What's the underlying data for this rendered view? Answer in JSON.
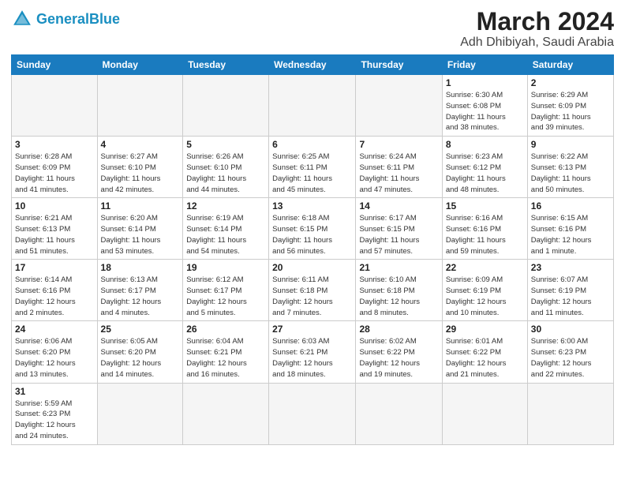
{
  "header": {
    "logo_general": "General",
    "logo_blue": "Blue",
    "title": "March 2024",
    "subtitle": "Adh Dhibiyah, Saudi Arabia"
  },
  "weekdays": [
    "Sunday",
    "Monday",
    "Tuesday",
    "Wednesday",
    "Thursday",
    "Friday",
    "Saturday"
  ],
  "weeks": [
    [
      {
        "day": "",
        "info": ""
      },
      {
        "day": "",
        "info": ""
      },
      {
        "day": "",
        "info": ""
      },
      {
        "day": "",
        "info": ""
      },
      {
        "day": "",
        "info": ""
      },
      {
        "day": "1",
        "info": "Sunrise: 6:30 AM\nSunset: 6:08 PM\nDaylight: 11 hours\nand 38 minutes."
      },
      {
        "day": "2",
        "info": "Sunrise: 6:29 AM\nSunset: 6:09 PM\nDaylight: 11 hours\nand 39 minutes."
      }
    ],
    [
      {
        "day": "3",
        "info": "Sunrise: 6:28 AM\nSunset: 6:09 PM\nDaylight: 11 hours\nand 41 minutes."
      },
      {
        "day": "4",
        "info": "Sunrise: 6:27 AM\nSunset: 6:10 PM\nDaylight: 11 hours\nand 42 minutes."
      },
      {
        "day": "5",
        "info": "Sunrise: 6:26 AM\nSunset: 6:10 PM\nDaylight: 11 hours\nand 44 minutes."
      },
      {
        "day": "6",
        "info": "Sunrise: 6:25 AM\nSunset: 6:11 PM\nDaylight: 11 hours\nand 45 minutes."
      },
      {
        "day": "7",
        "info": "Sunrise: 6:24 AM\nSunset: 6:11 PM\nDaylight: 11 hours\nand 47 minutes."
      },
      {
        "day": "8",
        "info": "Sunrise: 6:23 AM\nSunset: 6:12 PM\nDaylight: 11 hours\nand 48 minutes."
      },
      {
        "day": "9",
        "info": "Sunrise: 6:22 AM\nSunset: 6:13 PM\nDaylight: 11 hours\nand 50 minutes."
      }
    ],
    [
      {
        "day": "10",
        "info": "Sunrise: 6:21 AM\nSunset: 6:13 PM\nDaylight: 11 hours\nand 51 minutes."
      },
      {
        "day": "11",
        "info": "Sunrise: 6:20 AM\nSunset: 6:14 PM\nDaylight: 11 hours\nand 53 minutes."
      },
      {
        "day": "12",
        "info": "Sunrise: 6:19 AM\nSunset: 6:14 PM\nDaylight: 11 hours\nand 54 minutes."
      },
      {
        "day": "13",
        "info": "Sunrise: 6:18 AM\nSunset: 6:15 PM\nDaylight: 11 hours\nand 56 minutes."
      },
      {
        "day": "14",
        "info": "Sunrise: 6:17 AM\nSunset: 6:15 PM\nDaylight: 11 hours\nand 57 minutes."
      },
      {
        "day": "15",
        "info": "Sunrise: 6:16 AM\nSunset: 6:16 PM\nDaylight: 11 hours\nand 59 minutes."
      },
      {
        "day": "16",
        "info": "Sunrise: 6:15 AM\nSunset: 6:16 PM\nDaylight: 12 hours\nand 1 minute."
      }
    ],
    [
      {
        "day": "17",
        "info": "Sunrise: 6:14 AM\nSunset: 6:16 PM\nDaylight: 12 hours\nand 2 minutes."
      },
      {
        "day": "18",
        "info": "Sunrise: 6:13 AM\nSunset: 6:17 PM\nDaylight: 12 hours\nand 4 minutes."
      },
      {
        "day": "19",
        "info": "Sunrise: 6:12 AM\nSunset: 6:17 PM\nDaylight: 12 hours\nand 5 minutes."
      },
      {
        "day": "20",
        "info": "Sunrise: 6:11 AM\nSunset: 6:18 PM\nDaylight: 12 hours\nand 7 minutes."
      },
      {
        "day": "21",
        "info": "Sunrise: 6:10 AM\nSunset: 6:18 PM\nDaylight: 12 hours\nand 8 minutes."
      },
      {
        "day": "22",
        "info": "Sunrise: 6:09 AM\nSunset: 6:19 PM\nDaylight: 12 hours\nand 10 minutes."
      },
      {
        "day": "23",
        "info": "Sunrise: 6:07 AM\nSunset: 6:19 PM\nDaylight: 12 hours\nand 11 minutes."
      }
    ],
    [
      {
        "day": "24",
        "info": "Sunrise: 6:06 AM\nSunset: 6:20 PM\nDaylight: 12 hours\nand 13 minutes."
      },
      {
        "day": "25",
        "info": "Sunrise: 6:05 AM\nSunset: 6:20 PM\nDaylight: 12 hours\nand 14 minutes."
      },
      {
        "day": "26",
        "info": "Sunrise: 6:04 AM\nSunset: 6:21 PM\nDaylight: 12 hours\nand 16 minutes."
      },
      {
        "day": "27",
        "info": "Sunrise: 6:03 AM\nSunset: 6:21 PM\nDaylight: 12 hours\nand 18 minutes."
      },
      {
        "day": "28",
        "info": "Sunrise: 6:02 AM\nSunset: 6:22 PM\nDaylight: 12 hours\nand 19 minutes."
      },
      {
        "day": "29",
        "info": "Sunrise: 6:01 AM\nSunset: 6:22 PM\nDaylight: 12 hours\nand 21 minutes."
      },
      {
        "day": "30",
        "info": "Sunrise: 6:00 AM\nSunset: 6:23 PM\nDaylight: 12 hours\nand 22 minutes."
      }
    ],
    [
      {
        "day": "31",
        "info": "Sunrise: 5:59 AM\nSunset: 6:23 PM\nDaylight: 12 hours\nand 24 minutes."
      },
      {
        "day": "",
        "info": ""
      },
      {
        "day": "",
        "info": ""
      },
      {
        "day": "",
        "info": ""
      },
      {
        "day": "",
        "info": ""
      },
      {
        "day": "",
        "info": ""
      },
      {
        "day": "",
        "info": ""
      }
    ]
  ]
}
